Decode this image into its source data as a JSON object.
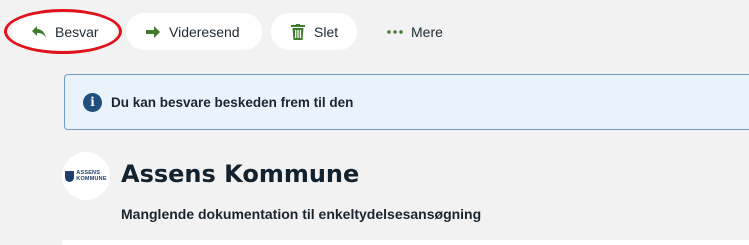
{
  "toolbar": {
    "reply_label": "Besvar",
    "forward_label": "Videresend",
    "delete_label": "Slet",
    "more_label": "Mere"
  },
  "info": {
    "message": "Du kan besvare beskeden frem til den"
  },
  "message": {
    "sender_logo_lines": [
      "ASSENS",
      "KOMMUNE"
    ],
    "sender": "Assens Kommune",
    "subject": "Manglende dokumentation til enkeltydelsesansøgning"
  },
  "colors": {
    "accent_green": "#3e7d2c",
    "highlight_red": "#e0121b",
    "info_icon": "#1f4f7d"
  }
}
